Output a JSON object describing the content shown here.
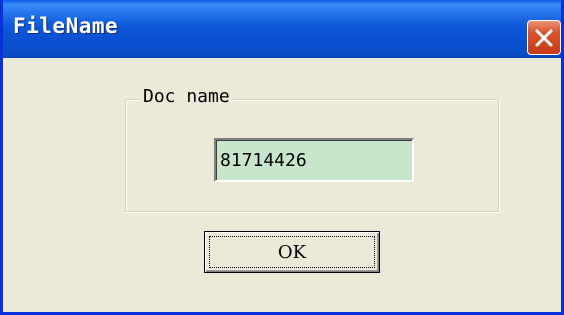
{
  "window": {
    "title": "FileName",
    "close_icon": "close-x-icon"
  },
  "group": {
    "label": "Doc name"
  },
  "doc_name_field": {
    "value": "81714426"
  },
  "buttons": {
    "ok_label": "OK"
  },
  "colors": {
    "title_bar": "#0a5ce8",
    "window_frame": "#0831d9",
    "close_button": "#d9542f",
    "dialog_background": "#ece9d8",
    "field_background": "#c8e6cc"
  }
}
